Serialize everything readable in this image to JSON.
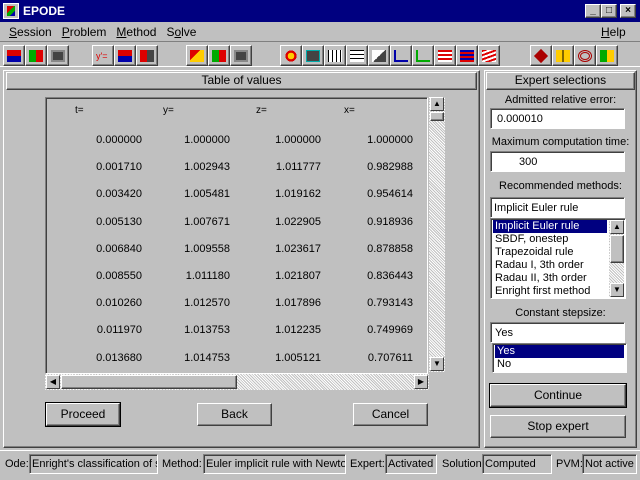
{
  "window": {
    "title": "EPODE"
  },
  "menu": [
    {
      "label": "Session",
      "ul": "S",
      "rest": "ession"
    },
    {
      "label": "Problem",
      "ul": "P",
      "rest": "roblem"
    },
    {
      "label": "Method",
      "ul": "M",
      "rest": "ethod"
    },
    {
      "label": "Solve",
      "pre": "S",
      "ul": "o",
      "rest": "lve"
    }
  ],
  "help": {
    "ul": "H",
    "rest": "elp"
  },
  "table_panel": {
    "title": "Table of values",
    "headers": [
      "t=",
      "y=",
      "z=",
      "x="
    ],
    "rows": [
      [
        "0.000000",
        "1.000000",
        "1.000000",
        "1.000000"
      ],
      [
        "0.001710",
        "1.002943",
        "1.011777",
        "0.982988"
      ],
      [
        "0.003420",
        "1.005481",
        "1.019162",
        "0.954614"
      ],
      [
        "0.005130",
        "1.007671",
        "1.022905",
        "0.918936"
      ],
      [
        "0.006840",
        "1.009558",
        "1.023617",
        "0.878858"
      ],
      [
        "0.008550",
        "1.011180",
        "1.021807",
        "0.836443"
      ],
      [
        "0.010260",
        "1.012570",
        "1.017896",
        "0.793143"
      ],
      [
        "0.011970",
        "1.013753",
        "1.012235",
        "0.749969"
      ],
      [
        "0.013680",
        "1.014753",
        "1.005121",
        "0.707611"
      ]
    ],
    "buttons": {
      "proceed": "Proceed",
      "back": "Back",
      "cancel": "Cancel"
    }
  },
  "expert_panel": {
    "title": "Expert selections",
    "error_label": "Admitted relative error:",
    "error_value": "0.000010",
    "time_label": "Maximum computation time:",
    "time_value": "300",
    "methods_label": "Recommended methods:",
    "method_value": "Implicit Euler rule",
    "methods": [
      "Implicit Euler rule",
      "SBDF, onestep",
      "Trapezoidal rule",
      "Radau I, 3th order",
      "Radau II, 3th order",
      "Enright first method"
    ],
    "selected_method_index": 0,
    "stepsize_label": "Constant stepsize:",
    "stepsize_value": "Yes",
    "stepsize_options": [
      "Yes",
      "No"
    ],
    "selected_stepsize_index": 0,
    "continue_label": "Continue",
    "stop_label": "Stop expert"
  },
  "status": {
    "ode_label": "Ode:",
    "ode_value": "Enright's classification of st",
    "method_label": "Method:",
    "method_value": "Euler implicit rule with Newton",
    "expert_label": "Expert:",
    "expert_value": "Activated",
    "solution_label": "Solution:",
    "solution_value": "Computed",
    "pvm_label": "PVM:",
    "pvm_value": "Not active"
  }
}
